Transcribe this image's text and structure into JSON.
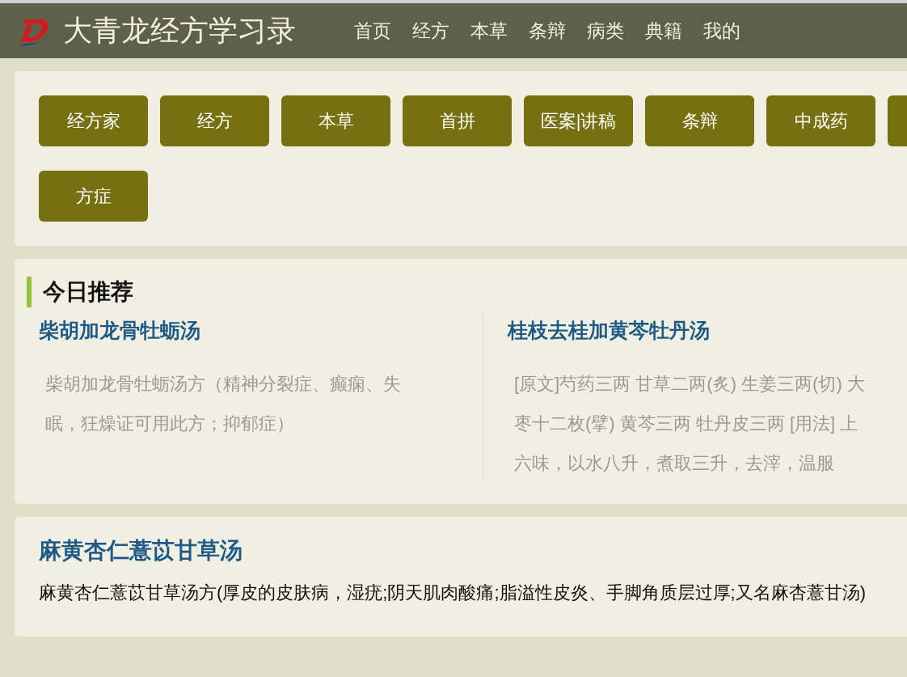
{
  "header": {
    "site_title": "大青龙经方学习录",
    "nav": [
      {
        "label": "首页"
      },
      {
        "label": "经方"
      },
      {
        "label": "本草"
      },
      {
        "label": "条辩"
      },
      {
        "label": "病类"
      },
      {
        "label": "典籍"
      },
      {
        "label": "我的"
      }
    ]
  },
  "categories": [
    {
      "label": "经方家"
    },
    {
      "label": "经方"
    },
    {
      "label": "本草"
    },
    {
      "label": "首拼"
    },
    {
      "label": "医案|讲稿"
    },
    {
      "label": "条辩"
    },
    {
      "label": "中成药"
    },
    {
      "label": "方症"
    }
  ],
  "recommend": {
    "heading": "今日推荐",
    "items": [
      {
        "title": "柴胡加龙骨牡蛎汤",
        "summary": "柴胡加龙骨牡蛎汤方（精神分裂症、癫痫、失眠，狂燥证可用此方；抑郁症）"
      },
      {
        "title": "桂枝去桂加黄芩牡丹汤",
        "summary": "[原文]芍药三两 甘草二两(炙) 生姜三两(切) 大枣十二枚(擘) 黄芩三两 牡丹皮三两 [用法] 上六味，以水八升，煮取三升，去滓，温服"
      }
    ]
  },
  "articles": [
    {
      "title": "麻黄杏仁薏苡甘草汤",
      "summary": "麻黄杏仁薏苡甘草汤方(厚皮的皮肤病，湿疣;阴天肌肉酸痛;脂溢性皮炎、手脚角质层过厚;又名麻杏薏甘汤)"
    }
  ]
}
